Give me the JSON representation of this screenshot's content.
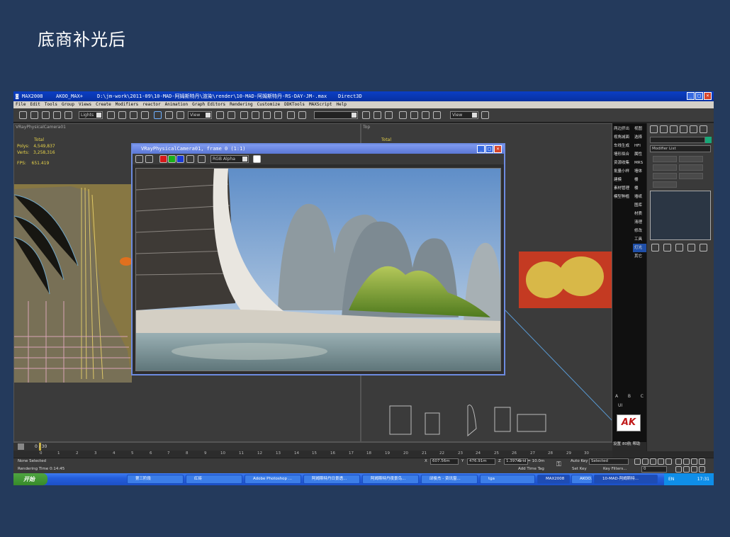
{
  "slide": {
    "title": "底商补光后"
  },
  "app": {
    "title_app": "MAX2008",
    "title_user": "AKOO_MAX+",
    "title_path": "D:\\jm-work\\2011-09\\10-MAD-阿姆斯特丹\\渲染\\render\\10-MAD-阿姆斯特丹-RS-DAY-JM-.max",
    "title_driver": "Direct3D"
  },
  "menu": [
    "File",
    "Edit",
    "Tools",
    "Group",
    "Views",
    "Create",
    "Modifiers",
    "reactor",
    "Animation",
    "Graph Editors",
    "Rendering",
    "Customize",
    "DDKTools",
    "MAXScript",
    "Help"
  ],
  "toolbar": {
    "selection_filter": "Lights",
    "ref_coord": "View",
    "ref_coord2": "View"
  },
  "viewport_left": {
    "label": "VRayPhysicalCamera01",
    "total_label": "Total",
    "polys_label": "Polys:",
    "polys_value": "4,549,837",
    "verts_label": "Verts:",
    "verts_value": "3,258,316",
    "fps_label": "FPS:",
    "fps_value": "651.419"
  },
  "viewport_right": {
    "label": "Top",
    "total_label": "Total"
  },
  "render_window": {
    "title": "VRayPhysicalCamera01, frame 0 (1:1)",
    "channel": "RGB Alpha"
  },
  "side_menu": {
    "col1": [
      "两边挤出",
      "视角减面",
      "车线生成",
      "墙形拟合",
      "资源收集",
      "批量小样",
      "建模",
      "素材管理",
      "模型种植"
    ],
    "col2": [
      "视图",
      "选择",
      "HFI",
      "属性",
      "MRS",
      "墙体",
      "楼",
      "楼",
      "墙纸",
      "图库",
      "材质",
      "清理",
      "修改",
      "工具",
      "灯光",
      "其它"
    ]
  },
  "cmd_panel": {
    "modifier_list": "Modifier List",
    "abc": [
      "A",
      "B",
      "C"
    ],
    "ui_label": "UI",
    "bottom_labels": [
      "设置",
      "80航",
      "帮助"
    ]
  },
  "timeline": {
    "frame_label": "0 / 30",
    "ticks": [
      "0",
      "1",
      "2",
      "3",
      "4",
      "5",
      "6",
      "7",
      "8",
      "9",
      "10",
      "11",
      "12",
      "13",
      "14",
      "15",
      "16",
      "17",
      "18",
      "19",
      "20",
      "21",
      "22",
      "23",
      "24",
      "25",
      "26",
      "27",
      "28",
      "29",
      "30"
    ]
  },
  "status": {
    "selection": "None Selected",
    "render_time": "Rendering Time  0:14:45",
    "x_label": "X",
    "x_value": "607.56m",
    "y_label": "Y",
    "y_value": "476.91m",
    "z_label": "Z",
    "z_value": "1.397m",
    "grid": "Grid = 10.0m",
    "add_time_tag": "Add Time Tag",
    "auto_key": "Auto Key",
    "set_key": "Set Key",
    "selected": "Selected",
    "key_filters": "Key Filters...",
    "frame_field": "0"
  },
  "taskbar": {
    "start": "开始",
    "tasks": [
      "第三阶段",
      "红砖",
      "Adobe Photoshop ...",
      "阿姆斯特丹日景透...",
      "阿姆斯特丹夜景鸟...",
      "邱俊杰 - 资讯窗...",
      "tga",
      "MAX2008",
      "AKOO...",
      "10-MAD-阿姆斯特..."
    ],
    "tray_lang": "EN",
    "tray_time": "17:31"
  },
  "colors": {
    "slide_bg": "#243a5c",
    "titlebar": "#0a3fc4",
    "viewport": "#3b3b3b"
  }
}
